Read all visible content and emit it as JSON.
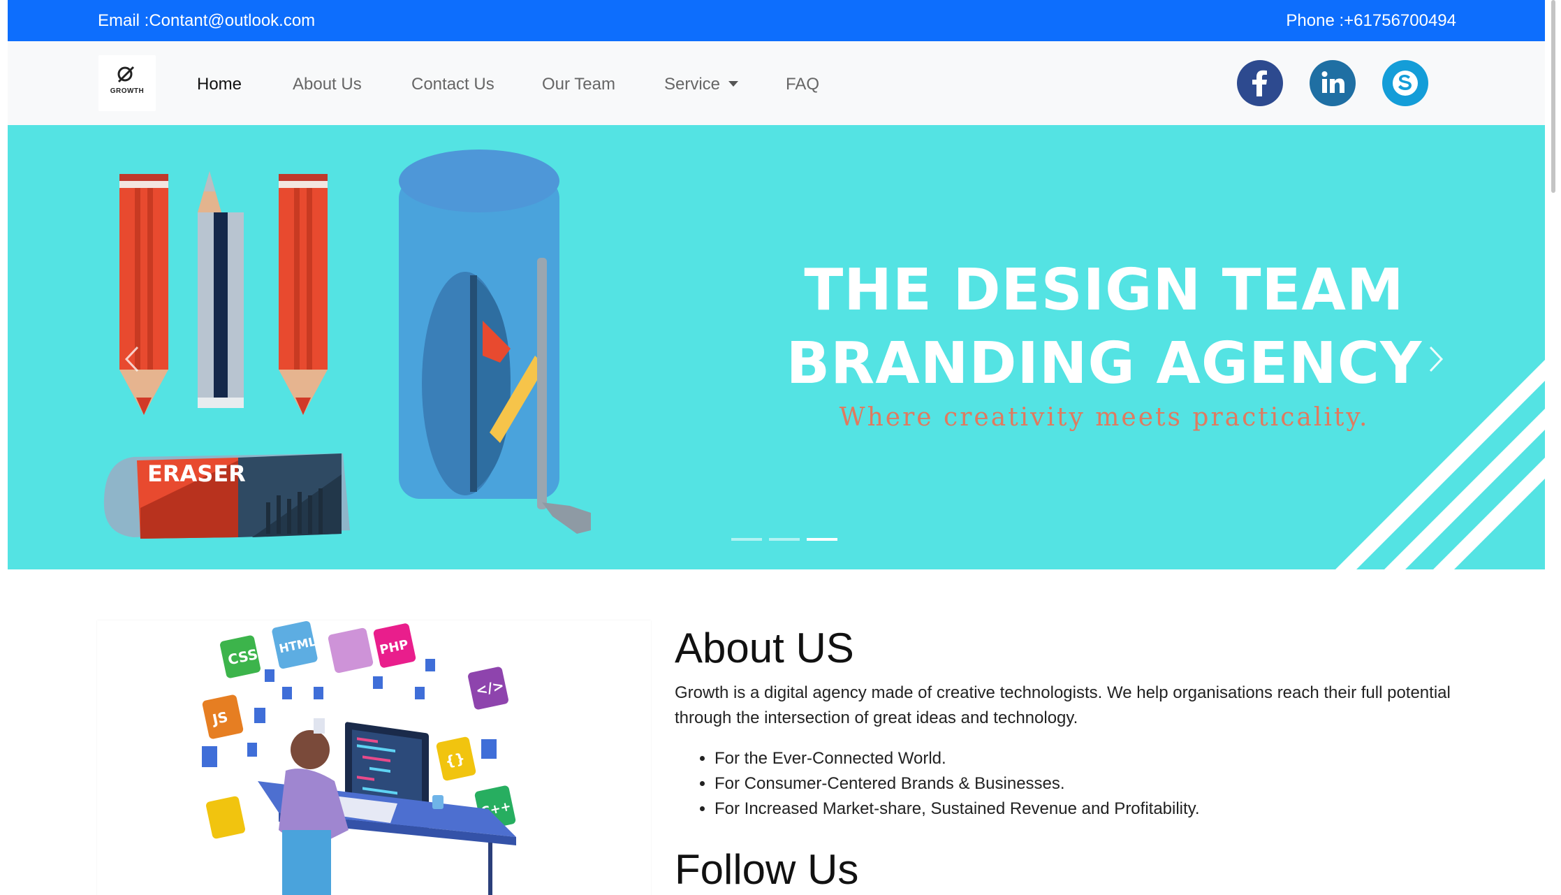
{
  "topbar": {
    "email": "Email :Contant@outlook.com",
    "phone": "Phone :+61756700494"
  },
  "logo": {
    "brand": "GROWTH",
    "tagline": ""
  },
  "nav": {
    "items": [
      {
        "label": "Home",
        "active": true
      },
      {
        "label": "About Us"
      },
      {
        "label": "Contact Us"
      },
      {
        "label": "Our Team"
      },
      {
        "label": "Service",
        "dropdown": true
      },
      {
        "label": "FAQ"
      }
    ]
  },
  "social": {
    "facebook_color": "#2d4a8f",
    "linkedin_color": "#1f6fa3",
    "skype_color": "#149dd8"
  },
  "hero": {
    "title_line1": "THE DESIGN TEAM",
    "title_line2": "BRANDING AGENCY",
    "subtitle": "Where creativity meets practicality.",
    "eraser_label": "ERASER",
    "background": "#54e3e3",
    "slide_count": 3,
    "active_slide": 3
  },
  "about": {
    "title": "About US",
    "text": "Growth is a digital agency made of creative technologists. We help organisations reach their full potential through the intersection of great ideas and technology.",
    "list": [
      "For the Ever-Connected World.",
      "For Consumer-Centered Brands & Businesses.",
      "For Increased Market-share, Sustained Revenue and Profitability."
    ],
    "image_tags": [
      "CSS",
      "HTML",
      "PHP",
      "</>",
      "JS",
      "{}",
      "C++"
    ]
  },
  "follow": {
    "title": "Follow Us"
  }
}
